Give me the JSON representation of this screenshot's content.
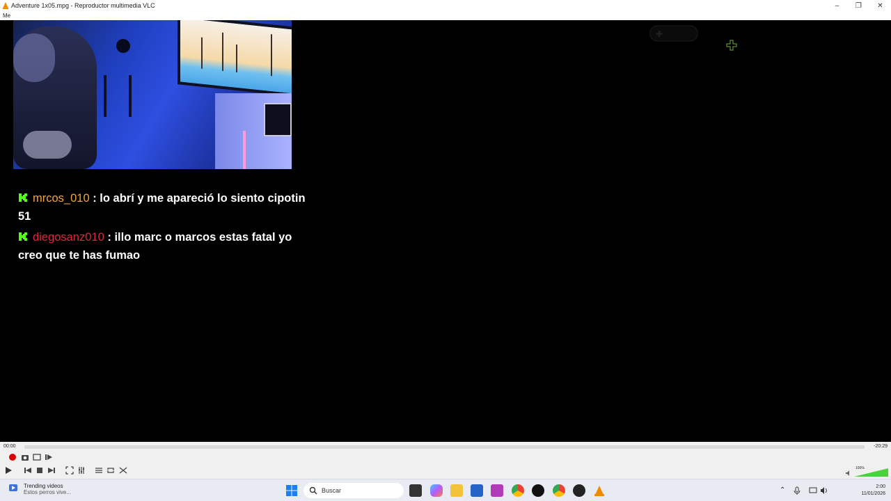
{
  "window": {
    "title": "Adventure 1x05.mpg - Reproductor multimedia VLC",
    "menu": "Me"
  },
  "chat": {
    "messages": [
      {
        "user": "mrcos_010",
        "user_color": "#f0a63c",
        "text": ": lo abrí y me apareció lo siento cipotin 51"
      },
      {
        "user": "diegosanz010",
        "user_color": "#e0243c",
        "text": ": illo marc o marcos estas fatal yo creo que te has fumao"
      }
    ],
    "badge_color": "#53fc18"
  },
  "player": {
    "elapsed": "00:00",
    "remaining": "-20:29",
    "volume": "100%"
  },
  "taskbar": {
    "widget_title": "Trending videos",
    "widget_sub": "Estos perros vive...",
    "search_placeholder": "Buscar",
    "time": "2:00",
    "date": "11/01/2026"
  }
}
